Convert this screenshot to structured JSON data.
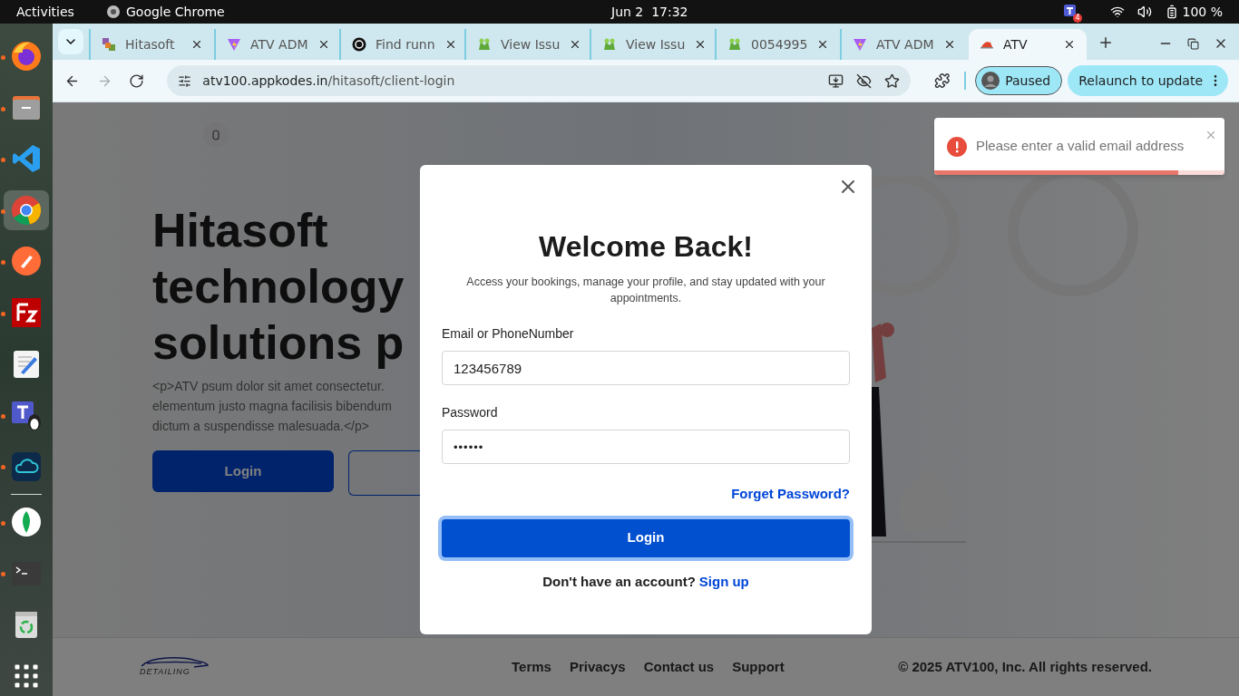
{
  "top_bar": {
    "activities": "Activities",
    "app_name": "Google Chrome",
    "clock": "Jun 2  17:32",
    "teams_badge": "4",
    "battery": "100 %"
  },
  "dock": [
    {
      "kind": "firefox",
      "running": true,
      "selected": false
    },
    {
      "kind": "files",
      "running": true,
      "selected": false
    },
    {
      "kind": "vscode",
      "running": true,
      "selected": false
    },
    {
      "kind": "chrome",
      "running": true,
      "selected": true
    },
    {
      "kind": "postman",
      "running": true,
      "selected": false
    },
    {
      "kind": "filezilla",
      "running": true,
      "selected": false
    },
    {
      "kind": "editor",
      "running": false,
      "selected": false
    },
    {
      "kind": "teams",
      "running": true,
      "selected": false
    },
    {
      "kind": "cloud",
      "running": true,
      "selected": false
    },
    {
      "kind": "mongo",
      "running": true,
      "selected": false
    },
    {
      "kind": "terminal",
      "running": true,
      "selected": false
    },
    {
      "kind": "trash",
      "running": false,
      "selected": false
    },
    {
      "kind": "apps",
      "running": false,
      "selected": false
    }
  ],
  "browser": {
    "tabs": [
      {
        "title": "Hitasoft",
        "kind": "grid",
        "selected": false
      },
      {
        "title": "ATV ADM",
        "kind": "vite",
        "selected": false
      },
      {
        "title": "Find runn",
        "kind": "knot",
        "selected": false
      },
      {
        "title": "View Issu",
        "kind": "bug",
        "selected": false
      },
      {
        "title": "View Issu",
        "kind": "bug",
        "selected": false
      },
      {
        "title": "0054995",
        "kind": "bug",
        "selected": false
      },
      {
        "title": "ATV ADM",
        "kind": "vite",
        "selected": false
      },
      {
        "title": "ATV",
        "kind": "atv",
        "selected": true
      }
    ],
    "nav": [
      {
        "kind": "back",
        "disabled": false
      },
      {
        "kind": "forward",
        "disabled": true
      },
      {
        "kind": "reload",
        "disabled": false
      }
    ],
    "address": {
      "host": "atv100.appkodes.in",
      "path": "/hitasoft/client-login"
    },
    "profile": "Paused",
    "relaunch": "Relaunch to update"
  },
  "page": {
    "heading_lines": [
      "Hitasoft",
      "technology",
      "solutions p"
    ],
    "paragraph_lines": [
      "<p>ATV psum dolor sit amet consectetur.",
      "elementum justo magna facilisis bibendum",
      "dictum a suspendisse malesuada.</p>"
    ],
    "login_button": "Login"
  },
  "modal": {
    "title": "Welcome Back!",
    "subtitle": "Access your bookings, manage your profile, and stay updated with your appointments.",
    "fields": [
      {
        "label": "Email or PhoneNumber",
        "value": "123456789",
        "kind": "text"
      },
      {
        "label": "Password",
        "value": "••••••",
        "kind": "password"
      }
    ],
    "forgot": "Forget Password?",
    "submit": {
      "label": "Login",
      "focused": true
    },
    "signup_prompt": "Don't have an account?",
    "signup_link": "Sign up"
  },
  "toast": {
    "message": "Please enter a valid email address",
    "level": 0.84
  },
  "footer": {
    "logo_text": "DETAILING",
    "links": [
      "Terms",
      "Privacys",
      "Contact us",
      "Support"
    ],
    "copyright": "© 2025 ATV100, Inc. All rights reserved."
  }
}
